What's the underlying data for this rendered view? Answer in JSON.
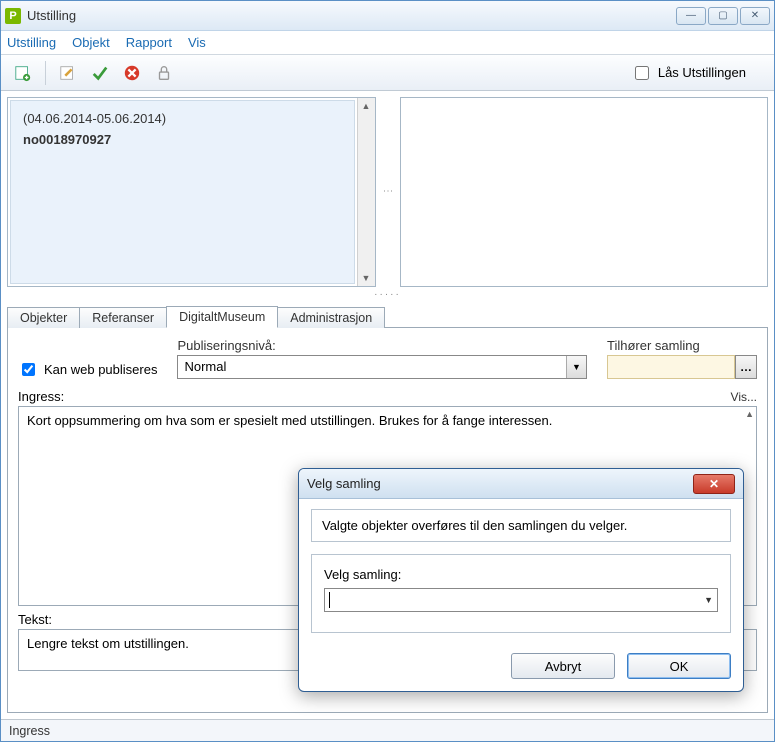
{
  "window": {
    "title": "Utstilling"
  },
  "menu": {
    "items": [
      "Utstilling",
      "Objekt",
      "Rapport",
      "Vis"
    ]
  },
  "toolbar": {
    "lock_label": "Lås Utstillingen"
  },
  "left_pane": {
    "date_range": "(04.06.2014-05.06.2014)",
    "identifier": "no0018970927"
  },
  "tabs": {
    "items": [
      "Objekter",
      "Referanser",
      "DigitaltMuseum",
      "Administrasjon"
    ],
    "active_index": 2
  },
  "form": {
    "web_publish_label": "Kan web publiseres",
    "web_publish_checked": true,
    "pubnivaa_label": "Publiseringsnivå:",
    "pubnivaa_value": "Normal",
    "samling_label": "Tilhører samling",
    "ingress_label": "Ingress:",
    "vis_label": "Vis...",
    "ingress_text": "Kort oppsummering om hva som er spesielt med utstillingen. Brukes for å fange interessen.",
    "tekst_label": "Tekst:",
    "tekst_text": "Lengre tekst om utstillingen."
  },
  "status": {
    "text": "Ingress"
  },
  "dialog": {
    "title": "Velg samling",
    "message": "Valgte objekter overføres til den samlingen du velger.",
    "field_label": "Velg samling:",
    "cancel": "Avbryt",
    "ok": "OK"
  }
}
